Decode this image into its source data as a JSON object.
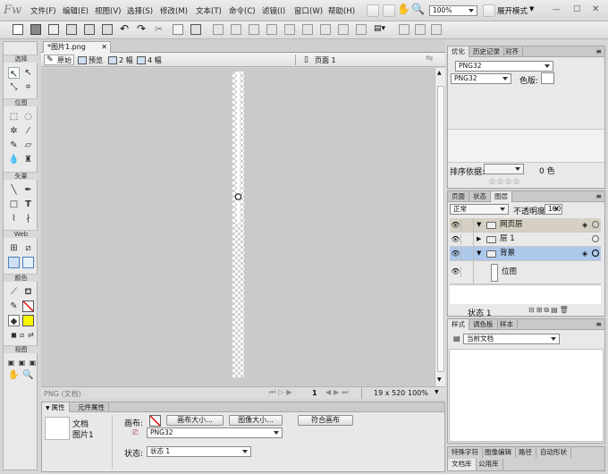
{
  "app": {
    "logo": "Fw"
  },
  "menu": [
    "文件(F)",
    "编辑(E)",
    "视图(V)",
    "选择(S)",
    "修改(M)",
    "文本(T)",
    "命令(C)",
    "滤镜(I)",
    "窗口(W)",
    "帮助(H)"
  ],
  "topbar": {
    "zoom": "100%",
    "workspace": "展开模式"
  },
  "tools": {
    "sections": [
      "选择",
      "位图",
      "矢量",
      "Web",
      "颜色",
      "视图"
    ]
  },
  "document": {
    "tab": "*图片1.png",
    "page": "页面 1"
  },
  "viewbar": {
    "original": "原始",
    "preview": "预览",
    "two_up": "2 幅",
    "four_up": "4 幅"
  },
  "status": {
    "format": "PNG (文档)",
    "page": "1",
    "size": "19 x 520",
    "zoom": "100%"
  },
  "properties": {
    "tab1": "属性",
    "tab2": "元件属性",
    "type": "文档",
    "name": "图片1",
    "canvas_label": "画布:",
    "canvas_size": "画布大小...",
    "image_size": "图像大小...",
    "fit_canvas": "符合画布",
    "format": "PNG32",
    "state_label": "状态:",
    "state_value": "状态 1"
  },
  "optimize": {
    "tab1": "优化",
    "tab2": "历史记录",
    "tab3": "对齐",
    "preset": "PNG32",
    "format": "PNG32",
    "matte_label": "色版:",
    "sort_label": "排序依据:",
    "colors": "0 色"
  },
  "layers": {
    "tab1": "页面",
    "tab2": "状态",
    "tab3": "图层",
    "blend": "正常",
    "opacity_label": "不透明度",
    "opacity": "100",
    "rows": [
      {
        "name": "网页层"
      },
      {
        "name": "层 1"
      },
      {
        "name": "背景"
      },
      {
        "name": "位图"
      }
    ],
    "footer": "状态 1"
  },
  "styles": {
    "tab1": "样式",
    "tab2": "调色板",
    "tab3": "样本",
    "select": "当前文档"
  },
  "bottomtabs": {
    "t1": "特殊字符",
    "t2": "图像编辑",
    "t3": "路径",
    "t4": "自动形状",
    "t5": "文档库",
    "t6": "公用库"
  },
  "colors": {
    "accent": "#f7f700",
    "selected_row": "#adc8ea",
    "web_layer": "#d6d0c4"
  }
}
